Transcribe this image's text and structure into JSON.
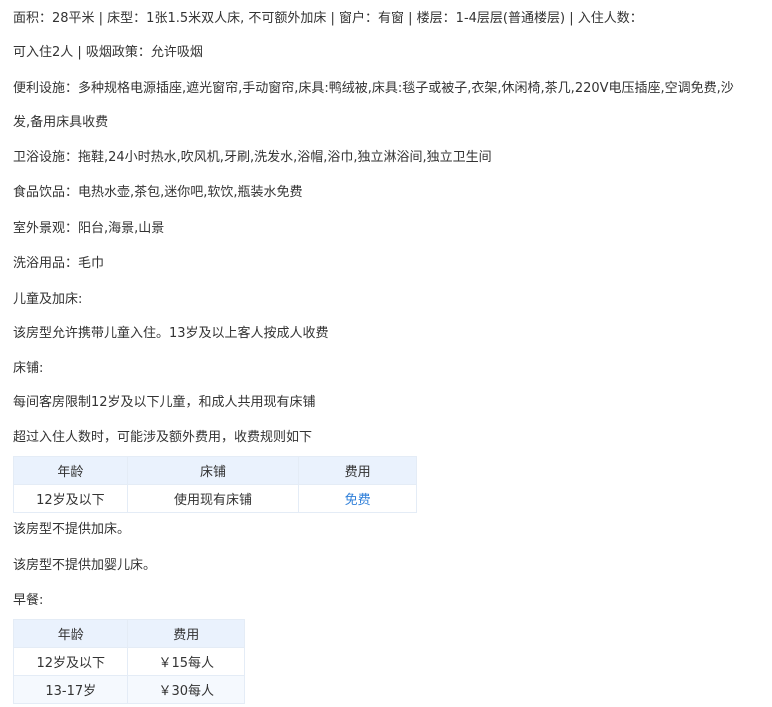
{
  "details": {
    "line1": "面积：28平米 | 床型：1张1.5米双人床, 不可额外加床 | 窗户：有窗 | 楼层：1-4层层(普通楼层) | 入住人数：",
    "line2": "可入住2人 | 吸烟政策：允许吸烟",
    "facilities_1": "便利设施：多种规格电源插座,遮光窗帘,手动窗帘,床具:鸭绒被,床具:毯子或被子,衣架,休闲椅,茶几,220V电压插座,空调免费,沙",
    "facilities_2": "发,备用床具收费",
    "bathroom": "卫浴设施：拖鞋,24小时热水,吹风机,牙刷,洗发水,浴帽,浴巾,独立淋浴间,独立卫生间",
    "food": "食品饮品：电热水壶,茶包,迷你吧,软饮,瓶装水免费",
    "view": "室外景观：阳台,海景,山景",
    "toiletries": "洗浴用品：毛巾"
  },
  "children": {
    "heading": "儿童及加床:",
    "policy": "该房型允许携带儿童入住。13岁及以上客人按成人收费"
  },
  "bedding": {
    "heading": "床铺:",
    "limit": "每间客房限制12岁及以下儿童，和成人共用现有床铺",
    "extra_note": "超过入住人数时，可能涉及额外费用，收费规则如下",
    "table": {
      "headers": [
        "年龄",
        "床铺",
        "费用"
      ],
      "rows": [
        [
          "12岁及以下",
          "使用现有床铺",
          "免费"
        ]
      ]
    },
    "no_extra_bed": "该房型不提供加床。",
    "no_crib": "该房型不提供加婴儿床。"
  },
  "breakfast": {
    "heading": "早餐:",
    "table": {
      "headers": [
        "年龄",
        "费用"
      ],
      "rows": [
        [
          "12岁及以下",
          "￥15每人"
        ],
        [
          "13-17岁",
          "￥30每人"
        ]
      ]
    }
  },
  "colors": {
    "header_bg": "#eaf2fd",
    "free_link": "#2f7fd9"
  }
}
